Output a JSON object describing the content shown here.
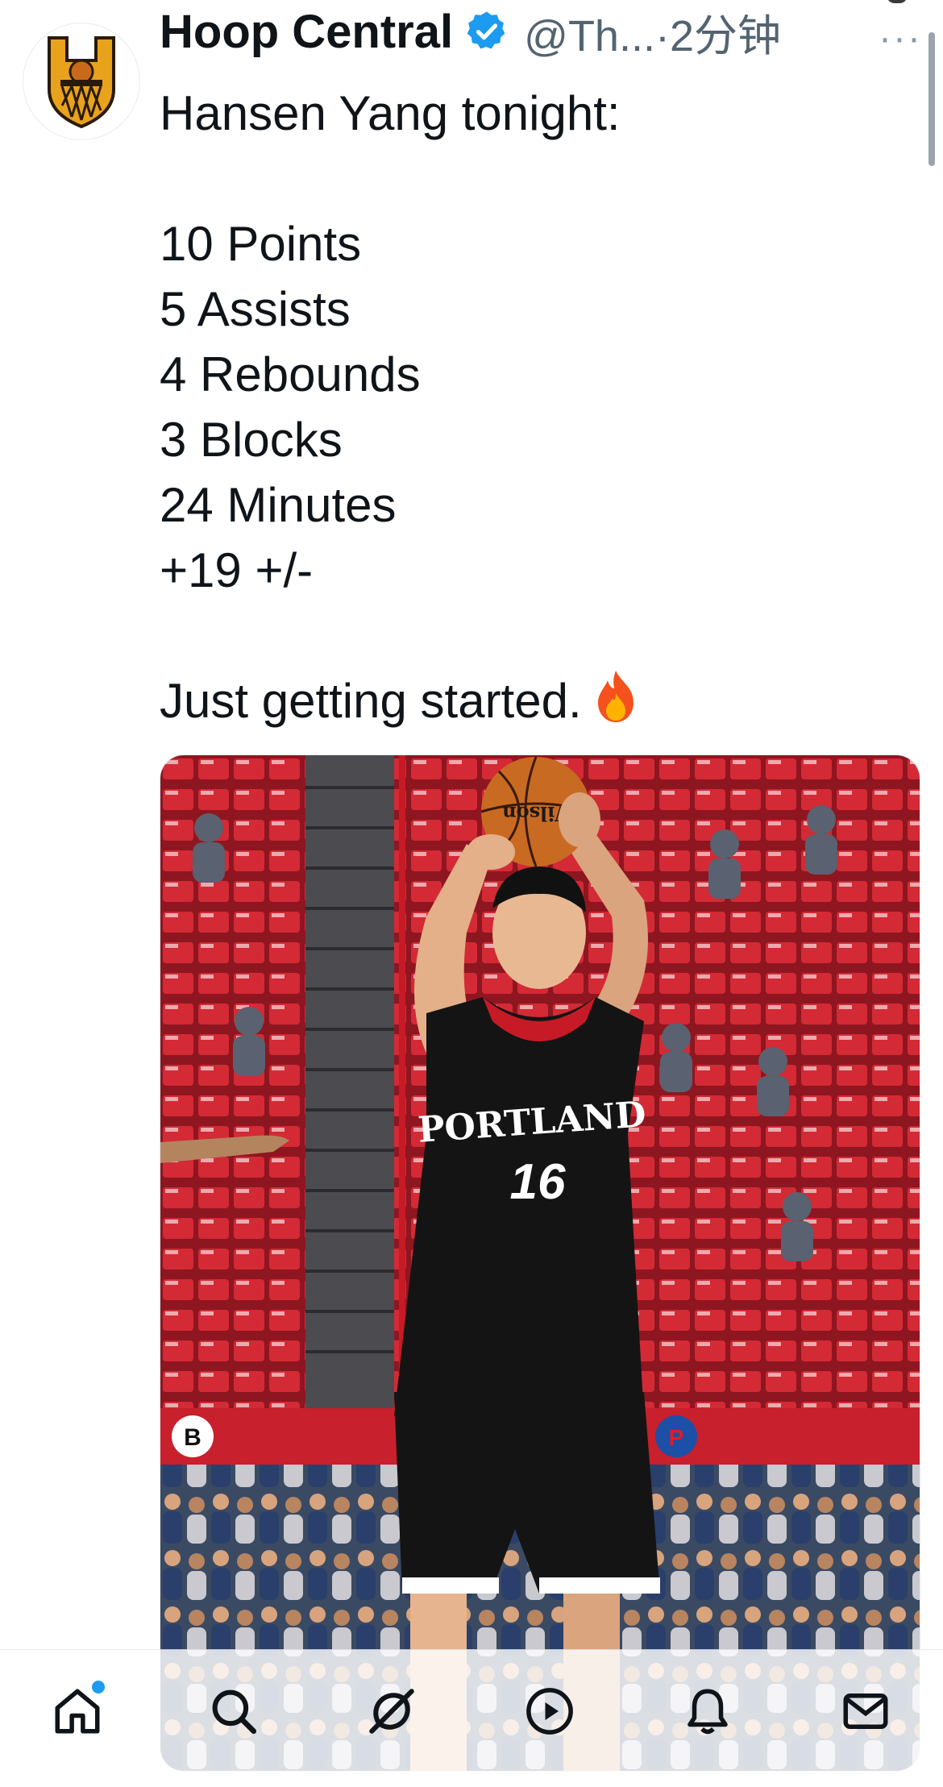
{
  "tweet": {
    "author_name": "Hoop Central",
    "handle_time": "@Th...·2分钟",
    "lines": [
      "Hansen Yang tonight:",
      "",
      "10 Points",
      "5 Assists",
      "4 Rebounds",
      "3 Blocks",
      "24 Minutes",
      "+19 +/-",
      "",
      "Just getting started."
    ],
    "emoji": "fire",
    "more_icon": "···"
  },
  "media": {
    "jersey_team": "PORTLAND",
    "jersey_number": "16",
    "ball_brand": "Wilson",
    "court_logos": [
      "B",
      "P"
    ]
  },
  "tabbar": {
    "items": [
      "home-icon",
      "search-icon",
      "grok-icon",
      "video-icon",
      "notifications-icon",
      "messages-icon"
    ],
    "active": "home-icon",
    "has_new_indicator": true
  },
  "colors": {
    "accent": "#1d9bf0",
    "text": "#0f1419",
    "secondary": "#536471",
    "logo_gold": "#e8a21c",
    "jersey": "#141414",
    "seat_red": "#c81f2b"
  }
}
